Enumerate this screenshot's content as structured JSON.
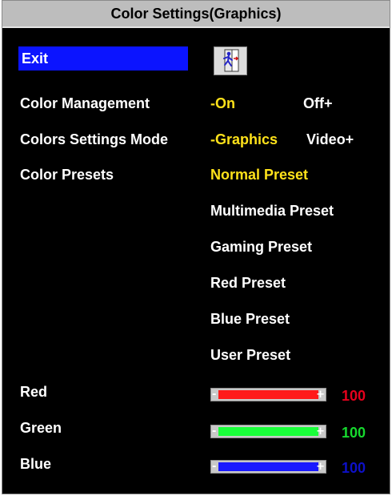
{
  "window": {
    "title": "Color Settings(Graphics)"
  },
  "menu": {
    "exit_label": "Exit",
    "exit_icon": "exit-door-icon",
    "color_management": {
      "label": "Color Management",
      "on": "-On",
      "off": "Off+"
    },
    "colors_settings_mode": {
      "label": "Colors Settings Mode",
      "graphics": "-Graphics",
      "video": "Video+"
    },
    "color_presets": {
      "label": "Color Presets",
      "items": [
        "Normal Preset",
        "Multimedia Preset",
        "Gaming Preset",
        "Red Preset",
        "Blue Preset",
        "User Preset"
      ],
      "selected": "Normal Preset"
    },
    "sliders": {
      "red": {
        "label": "Red",
        "value": "100",
        "level": 1.0,
        "color": "#ff1a1a"
      },
      "green": {
        "label": "Green",
        "value": "100",
        "level": 1.0,
        "color": "#1aff3a"
      },
      "blue": {
        "label": "Blue",
        "value": "100",
        "level": 1.0,
        "color": "#1a1aff"
      }
    },
    "colors": {
      "title_bg": "#bdbdbd",
      "highlight_bg": "#0b14ff",
      "selected_text": "#ffe21a",
      "value_red": "#e6001c",
      "value_green": "#16d92e",
      "value_blue": "#0d10c8"
    }
  }
}
